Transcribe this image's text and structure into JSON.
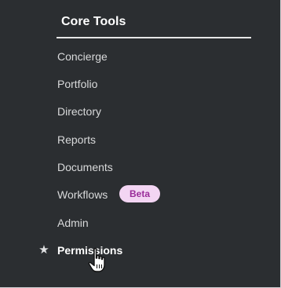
{
  "core_tools": {
    "heading": "Core Tools",
    "items": [
      {
        "label": "Concierge"
      },
      {
        "label": "Portfolio"
      },
      {
        "label": "Directory"
      },
      {
        "label": "Reports"
      },
      {
        "label": "Documents"
      },
      {
        "label": "Workflows",
        "badge": "Beta"
      },
      {
        "label": "Admin"
      },
      {
        "label": "Permissions",
        "starred": true,
        "hovered": true
      }
    ]
  },
  "icons": {
    "star": "star-icon",
    "cursor": "hand-pointer-icon"
  },
  "colors": {
    "menu_background": "#2b2e31",
    "text": "#d9dadb",
    "active_text": "#ffffff",
    "badge_background": "#f3d5f3",
    "badge_text": "#9a2d9a"
  }
}
